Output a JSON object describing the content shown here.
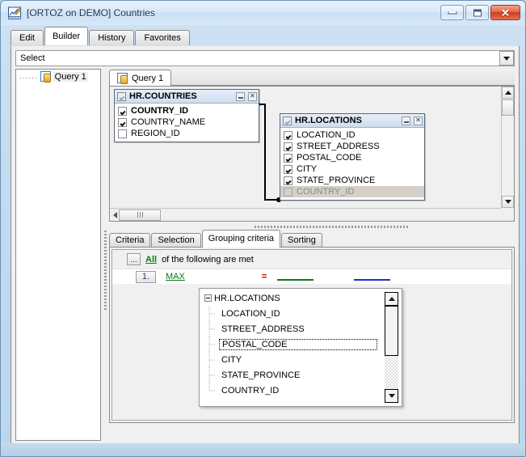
{
  "window": {
    "title": "[ORTOZ on DEMO] Countries",
    "icon": "query-builder-icon",
    "buttons": {
      "minimize": "minimize-button",
      "maximize": "maximize-button",
      "close": "✕"
    }
  },
  "top_tabs": [
    {
      "label": "Edit",
      "active": false
    },
    {
      "label": "Builder",
      "active": true
    },
    {
      "label": "History",
      "active": false
    },
    {
      "label": "Favorites",
      "active": false
    }
  ],
  "statement_combo": {
    "value": "Select",
    "arrow_icon": "chevron-down-icon"
  },
  "tree": {
    "items": [
      {
        "label": "Query 1",
        "icon": "query-icon",
        "selected": true
      }
    ]
  },
  "query_tabs": [
    {
      "label": "Query 1",
      "icon": "query-icon",
      "active": true
    }
  ],
  "diagram": {
    "tables": [
      {
        "name": "HR.COUNTRIES",
        "header_checkbox": "checked",
        "fields": [
          {
            "name": "COUNTRY_ID",
            "checked": true,
            "bold": true,
            "selected": false
          },
          {
            "name": "COUNTRY_NAME",
            "checked": true,
            "bold": false,
            "selected": false
          },
          {
            "name": "REGION_ID",
            "checked": false,
            "bold": false,
            "selected": false
          }
        ]
      },
      {
        "name": "HR.LOCATIONS",
        "header_checkbox": "checked",
        "fields": [
          {
            "name": "LOCATION_ID",
            "checked": true,
            "bold": false,
            "selected": false
          },
          {
            "name": "STREET_ADDRESS",
            "checked": true,
            "bold": false,
            "selected": false
          },
          {
            "name": "POSTAL_CODE",
            "checked": true,
            "bold": false,
            "selected": false
          },
          {
            "name": "CITY",
            "checked": true,
            "bold": false,
            "selected": false
          },
          {
            "name": "STATE_PROVINCE",
            "checked": true,
            "bold": false,
            "selected": false
          },
          {
            "name": "COUNTRY_ID",
            "checked": false,
            "bold": false,
            "selected": true
          }
        ]
      }
    ],
    "join": {
      "from": "HR.COUNTRIES.COUNTRY_ID",
      "to": "HR.LOCATIONS.COUNTRY_ID"
    }
  },
  "bottom_tabs": [
    {
      "label": "Criteria",
      "active": false
    },
    {
      "label": "Selection",
      "active": false
    },
    {
      "label": "Grouping criteria",
      "active": true
    },
    {
      "label": "Sorting",
      "active": false
    }
  ],
  "grouping": {
    "ellipsis_label": "...",
    "all_link": "All",
    "all_text": "of the following are met",
    "condition": {
      "number": "1.",
      "function": "MAX",
      "operator": "=",
      "left_placeholder": "",
      "right_placeholder": ""
    }
  },
  "dropdown": {
    "root": {
      "label": "HR.LOCATIONS",
      "expanded": true
    },
    "items": [
      {
        "label": "LOCATION_ID",
        "focused": false
      },
      {
        "label": "STREET_ADDRESS",
        "focused": false
      },
      {
        "label": "POSTAL_CODE",
        "focused": true
      },
      {
        "label": "CITY",
        "focused": false
      },
      {
        "label": "STATE_PROVINCE",
        "focused": false
      },
      {
        "label": "COUNTRY_ID",
        "focused": false
      }
    ],
    "scroll_up_icon": "triangle-up-icon",
    "scroll_down_icon": "triangle-down-icon"
  },
  "colors": {
    "link_green": "#0a7a17",
    "operator_red": "#cc0000",
    "placeholder_blue": "#1d2fd0",
    "title_text": "#113355",
    "selected_row": "#d4d0c8"
  }
}
